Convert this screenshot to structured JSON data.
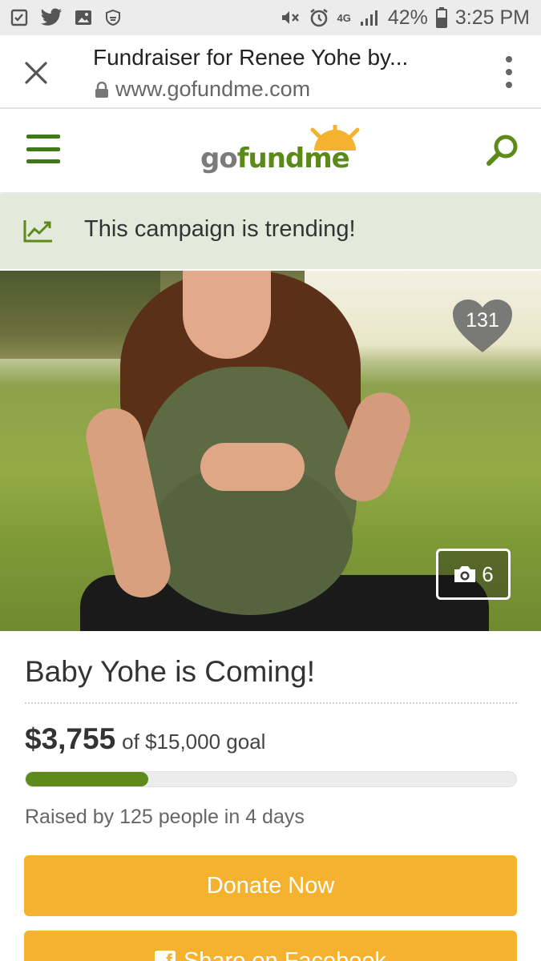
{
  "status_bar": {
    "left_icons": [
      "checklist-icon",
      "twitter-icon",
      "gallery-icon",
      "shield-icon"
    ],
    "right_icons": [
      "mute-icon",
      "alarm-icon",
      "lte-icon",
      "signal-icon"
    ],
    "network": "4G",
    "battery": "42%",
    "time": "3:25 PM"
  },
  "browser": {
    "title": "Fundraiser for Renee Yohe by...",
    "url": "www.gofundme.com"
  },
  "header": {
    "logo_part1": "go",
    "logo_part2": "fundme"
  },
  "trending": {
    "text": "This campaign is trending!"
  },
  "hero": {
    "likes": "131",
    "photo_count": "6"
  },
  "campaign": {
    "title": "Baby Yohe is Coming!",
    "raised": "$3,755",
    "goal_text": "of $15,000 goal",
    "progress_fraction": 0.25,
    "raised_by": "Raised by 125 people in 4 days"
  },
  "buttons": {
    "donate": "Donate Now",
    "share": "Share on Facebook"
  },
  "colors": {
    "brand_green": "#5d8a1a",
    "accent_orange": "#f4b22e",
    "trending_bg": "#e4eadb"
  }
}
